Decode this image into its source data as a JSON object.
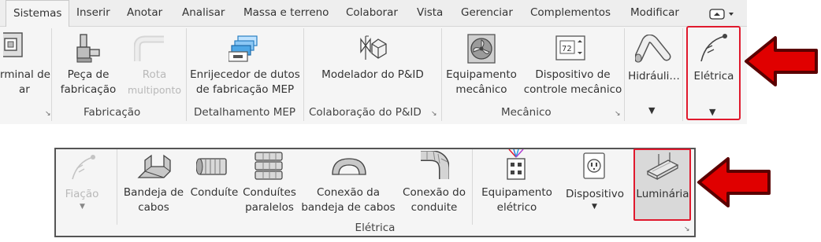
{
  "tabs": [
    {
      "id": "sistemas",
      "label": "Sistemas",
      "active": true
    },
    {
      "id": "inserir",
      "label": "Inserir"
    },
    {
      "id": "anotar",
      "label": "Anotar"
    },
    {
      "id": "analisar",
      "label": "Analisar"
    },
    {
      "id": "massa",
      "label": "Massa e terreno"
    },
    {
      "id": "colaborar",
      "label": "Colaborar"
    },
    {
      "id": "vista",
      "label": "Vista"
    },
    {
      "id": "gerenciar",
      "label": "Gerenciar"
    },
    {
      "id": "complementos",
      "label": "Complementos"
    },
    {
      "id": "modificar",
      "label": "Modificar"
    }
  ],
  "ribbon": {
    "terminal_line1": "rminal de",
    "terminal_line2": "ar",
    "peca_line1": "Peça de",
    "peca_line2": "fabricação",
    "rota_line1": "Rota",
    "rota_line2": "multiponto",
    "fabricacao_panel": "Fabricação",
    "enrij_line1": "Enrijecedor de dutos",
    "enrij_line2": "de fabricação MEP",
    "detalhamento_panel": "Detalhamento MEP",
    "modelador": "Modelador do P&ID",
    "colaboracao_panel": "Colaboração do P&ID",
    "equip_line1": "Equipamento",
    "equip_line2": "mecânico",
    "disp_line1": "Dispositivo de",
    "disp_line2": "controle mecânico",
    "mecanico_panel": "Mecânico",
    "hidraulica": "Hidráuli…",
    "eletrica": "Elétrica",
    "dial_value": "72"
  },
  "panel2": {
    "fiacao": "Fiação",
    "bandeja_line1": "Bandeja de",
    "bandeja_line2": "cabos",
    "conduite": "Conduíte",
    "condpar_line1": "Conduítes",
    "condpar_line2": "paralelos",
    "conexb_line1": "Conexão da",
    "conexb_line2": "bandeja de cabos",
    "conexc_line1": "Conexão do",
    "conexc_line2": "conduite",
    "equipel_line1": "Equipamento",
    "equipel_line2": "elétrico",
    "dispositivo": "Dispositivo",
    "luminaria": "Luminária",
    "panel_label": "Elétrica"
  },
  "colors": {
    "highlight": "#e0192d",
    "arrow": "#e00000",
    "arrow_outline": "#5a0000"
  },
  "icons": [
    "panel-expand-icon",
    "terminal-icon",
    "fabrication-part-icon",
    "multipoint-route-icon",
    "duct-stiffener-icon",
    "pid-modeler-icon",
    "mechanical-equipment-icon",
    "mechanical-control-icon",
    "plumbing-icon",
    "electrical-wire-icon",
    "cable-tray-icon",
    "conduit-icon",
    "parallel-conduits-icon",
    "cable-tray-fitting-icon",
    "conduit-fitting-icon",
    "electrical-equipment-icon",
    "device-outlet-icon",
    "lighting-fixture-icon",
    "red-arrow-icon"
  ]
}
